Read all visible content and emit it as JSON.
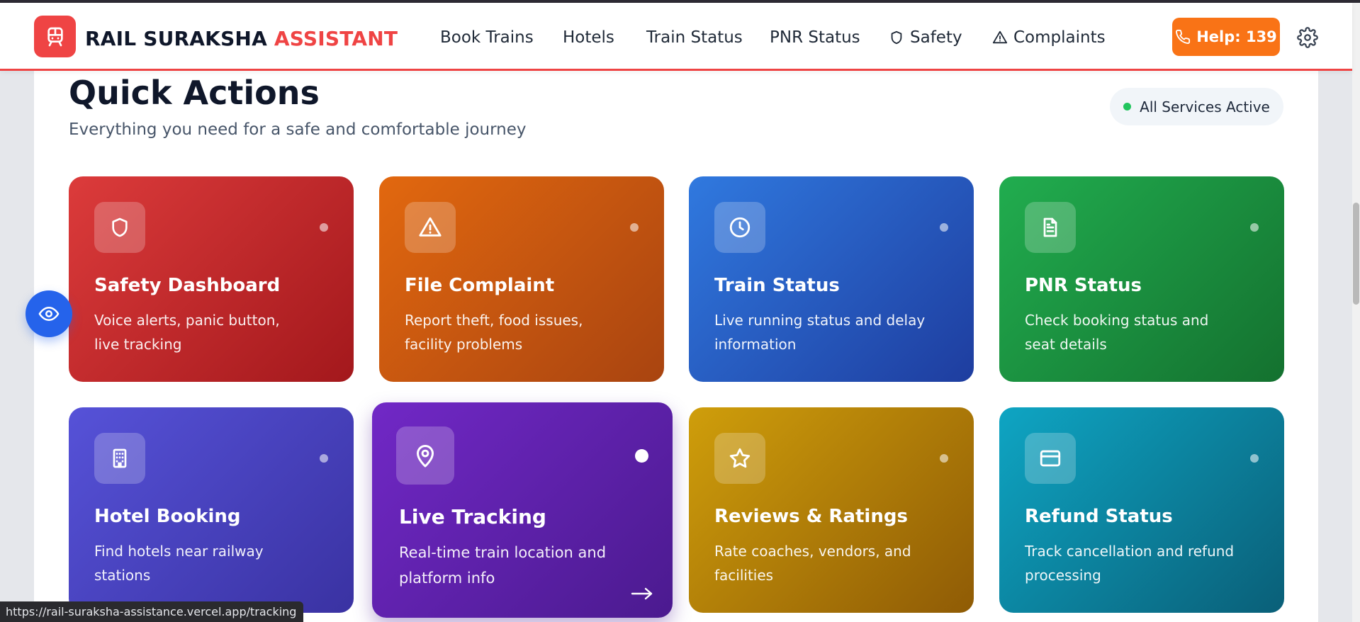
{
  "header": {
    "brand_main": "RAIL SURAKSHA",
    "brand_accent": "ASSISTANT",
    "nav": [
      {
        "label": "Book Trains",
        "icon": ""
      },
      {
        "label": "Hotels",
        "icon": ""
      },
      {
        "label": "Train Status",
        "icon": ""
      },
      {
        "label": "PNR Status",
        "icon": ""
      },
      {
        "label": "Safety",
        "icon": "shield-icon"
      },
      {
        "label": "Complaints",
        "icon": "warning-icon"
      }
    ],
    "help_label": "Help: 139",
    "colors": {
      "brand": "#ef4444",
      "help": "#f97316"
    }
  },
  "main": {
    "title": "Quick Actions",
    "subtitle": "Everything you need for a safe and comfortable journey",
    "status_label": "All Services Active",
    "status_color": "#22c55e"
  },
  "cards": [
    {
      "title": "Safety Dashboard",
      "description": "Voice alerts, panic button, live tracking",
      "icon": "shield-icon",
      "color": "#c62a2d"
    },
    {
      "title": "File Complaint",
      "description": "Report theft, food issues, facility problems",
      "icon": "warning-icon",
      "color": "#c9560f"
    },
    {
      "title": "Train Status",
      "description": "Live running status and delay information",
      "icon": "clock-icon",
      "color": "#2a5bc4"
    },
    {
      "title": "PNR Status",
      "description": "Check booking status and seat details",
      "icon": "document-icon",
      "color": "#1b8f3f"
    },
    {
      "title": "Hotel Booking",
      "description": "Find hotels near railway stations",
      "icon": "building-icon",
      "color": "#4a44c4"
    },
    {
      "title": "Live Tracking",
      "description": "Real-time train location and platform info",
      "icon": "map-pin-icon",
      "color": "#5d21ab"
    },
    {
      "title": "Reviews & Ratings",
      "description": "Rate coaches, vendors, and facilities",
      "icon": "star-icon",
      "color": "#b07f08"
    },
    {
      "title": "Refund Status",
      "description": "Track cancellation and refund processing",
      "icon": "credit-card-icon",
      "color": "#0c829e"
    }
  ],
  "status_bar": {
    "url": "https://rail-suraksha-assistance.vercel.app/tracking"
  }
}
